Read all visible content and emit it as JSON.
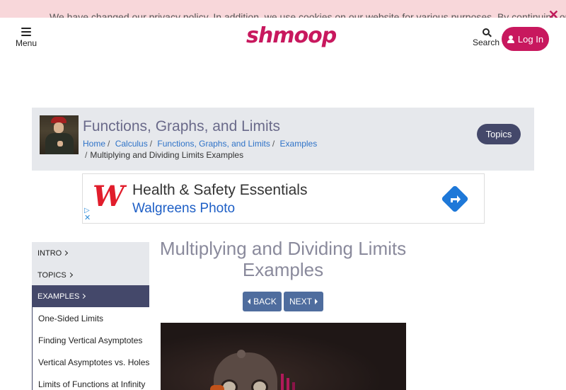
{
  "cookie_banner": {
    "text": "We have changed our privacy policy. In addition, we use cookies on our website for various purposes. By continuing on our",
    "close_glyph": "✕"
  },
  "header": {
    "menu_label": "Menu",
    "logo_text": "shmoop",
    "search_label": "Search",
    "login_label": "Log In"
  },
  "topic_banner": {
    "title": "Functions, Graphs, and Limits",
    "breadcrumbs": [
      "Home",
      "Calculus",
      "Functions, Graphs, and Limits",
      "Examples"
    ],
    "current_page": "Multiplying and Dividing Limits Examples",
    "separator": "/",
    "topics_button": "Topics"
  },
  "ad": {
    "logo_letter": "W",
    "headline": "Health & Safety Essentials",
    "subline": "Walgreens Photo",
    "info_glyph": "▷",
    "close_glyph": "✕"
  },
  "sidebar": {
    "sections": [
      {
        "label": "INTRO",
        "active": false
      },
      {
        "label": "TOPICS",
        "active": false
      },
      {
        "label": "EXAMPLES",
        "active": true
      }
    ],
    "sub_items": [
      "One-Sided Limits",
      "Finding Vertical Asymptotes",
      "Vertical Asymptotes vs. Holes",
      "Limits of Functions at Infinity"
    ]
  },
  "main": {
    "title_line1": "Multiplying and Dividing Limits",
    "title_line2": "Examples",
    "back_label": "BACK",
    "next_label": "NEXT"
  },
  "colors": {
    "brand": "#c8185e",
    "nav_dark": "#44486a",
    "link": "#2f73c8",
    "button_blue": "#4f6d9e"
  }
}
